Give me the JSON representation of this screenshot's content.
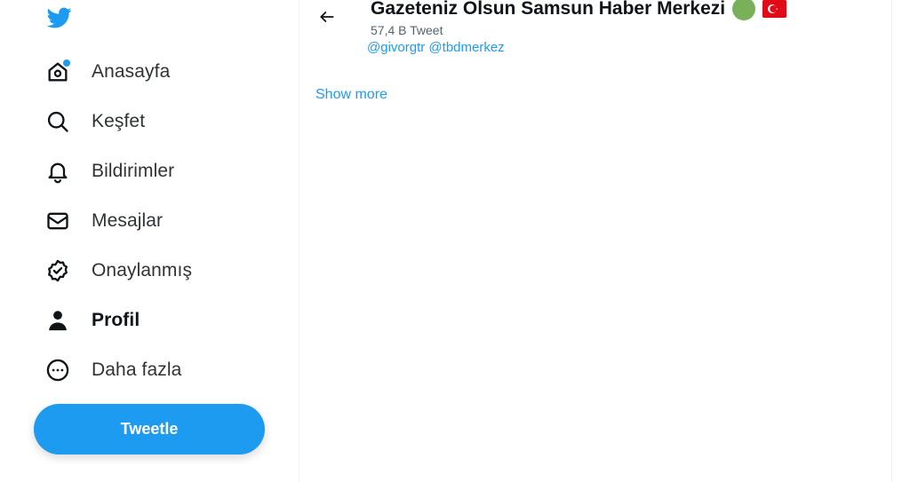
{
  "brand": {
    "logo_icon": "twitter-bird-icon",
    "accent_color": "#1d9bf0"
  },
  "nav": [
    {
      "key": "home",
      "label": "Anasayfa",
      "icon": "home-icon",
      "has_notification_dot": true
    },
    {
      "key": "explore",
      "label": "Keşfet",
      "icon": "search-icon"
    },
    {
      "key": "notifications",
      "label": "Bildirimler",
      "icon": "bell-icon"
    },
    {
      "key": "messages",
      "label": "Mesajlar",
      "icon": "envelope-icon"
    },
    {
      "key": "verified",
      "label": "Onaylanmış",
      "icon": "verified-badge-icon"
    },
    {
      "key": "profile",
      "label": "Profil",
      "icon": "person-icon",
      "active": true
    },
    {
      "key": "more",
      "label": "Daha fazla",
      "icon": "more-circle-icon"
    }
  ],
  "tweet_button": {
    "label": "Tweetle"
  },
  "profile_header": {
    "name": "Gazeteniz Olsun Samsun Haber Merkezi",
    "emojis": [
      "green-circle",
      "turkey-flag"
    ],
    "tweet_count": "57,4 B Tweet",
    "mention_1": "@givorgtr",
    "mention_2": "@tbdmerkez",
    "show_more": "Show more"
  }
}
